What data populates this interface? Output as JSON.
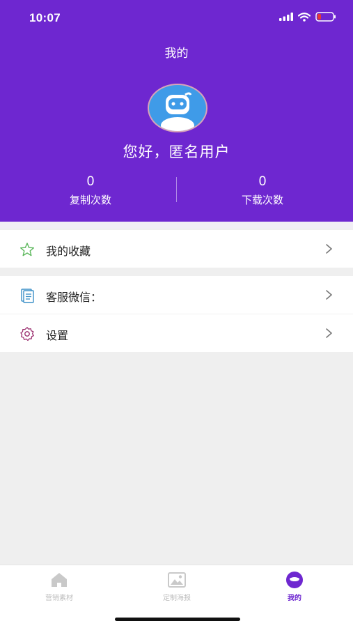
{
  "status_bar": {
    "time": "10:07"
  },
  "header": {
    "title": "我的",
    "greeting": "您好，匿名用户",
    "stats": [
      {
        "value": "0",
        "label": "复制次数"
      },
      {
        "value": "0",
        "label": "下载次数"
      }
    ]
  },
  "menu": {
    "favorites": {
      "label": "我的收藏",
      "icon": "star-icon"
    },
    "wechat_service": {
      "label": "客服微信：",
      "icon": "document-icon"
    },
    "settings": {
      "label": "设置",
      "icon": "gear-icon"
    }
  },
  "tabbar": {
    "tabs": [
      {
        "label": "营销素材",
        "icon": "home-icon",
        "active": false
      },
      {
        "label": "定制海报",
        "icon": "image-icon",
        "active": false
      },
      {
        "label": "我的",
        "icon": "profile-icon",
        "active": true
      }
    ]
  },
  "colors": {
    "primary": "#6e27d0",
    "background": "#efefef",
    "star": "#5cb85c",
    "doc": "#3a8fc7",
    "gear": "#9b2f6f"
  }
}
